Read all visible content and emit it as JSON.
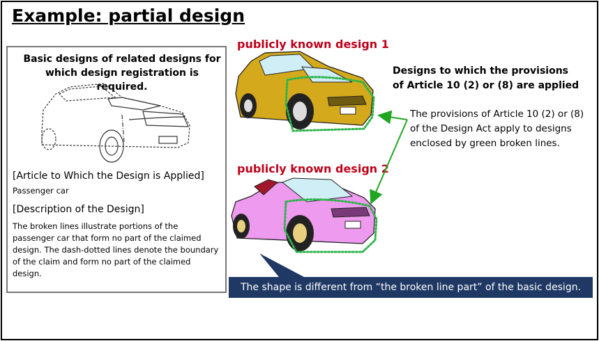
{
  "title": "Example: partial design",
  "left_panel": {
    "heading": "Basic designs of related designs for which design registration is required.",
    "article_heading": "[Article to Which the Design is Applied]",
    "article_value": "Passenger car",
    "description_heading": "[Description of the Design]",
    "description_text": "The broken lines illustrate portions of the passenger car that form no part of the claimed design. The dash-dotted lines denote the boundary of the claim and form no part of the claimed design."
  },
  "known_design_1": {
    "label": "publicly known design 1",
    "color": "#d4a91c"
  },
  "known_design_2": {
    "label": "publicly known design 2",
    "color": "#ee9aee"
  },
  "right_panel": {
    "heading": "Designs to which the provisions of Article 10 (2) or (8) are applied",
    "text": "The provisions of Article 10 (2) or (8) of the Design Act apply to designs enclosed by green broken lines."
  },
  "callout": {
    "text": "The shape is different from “the broken line part” of the basic design.",
    "color": "#1f3864"
  },
  "colors": {
    "label_red": "#c0001a",
    "arrow_green": "#22a522",
    "boundary_green": "#2db34a"
  },
  "icons": [
    "line-drawing-car-icon",
    "yellow-car-icon",
    "pink-convertible-car-icon",
    "double-arrow-icon"
  ]
}
